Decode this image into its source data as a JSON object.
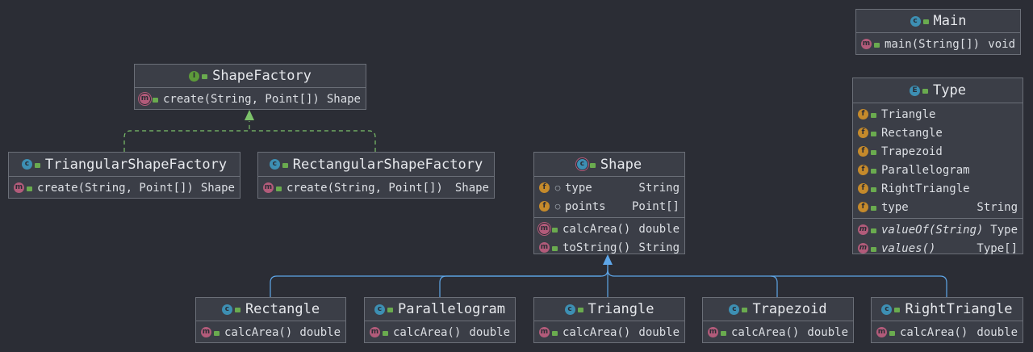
{
  "colors": {
    "background": "#2b2d35",
    "box_fill": "#3b3e47",
    "border": "#6b6f78",
    "inherit_edge": "#5ea6e8",
    "realize_edge": "#7cc26a"
  },
  "main": {
    "title": "Main",
    "methods": [
      {
        "name": "main(String[])",
        "type": "void"
      }
    ]
  },
  "shape_factory": {
    "title": "ShapeFactory",
    "methods": [
      {
        "name": "create(String, Point[])",
        "type": "Shape"
      }
    ]
  },
  "triangular_factory": {
    "title": "TriangularShapeFactory",
    "methods": [
      {
        "name": "create(String, Point[])",
        "type": "Shape"
      }
    ]
  },
  "rectangular_factory": {
    "title": "RectangularShapeFactory",
    "methods": [
      {
        "name": "create(String, Point[])",
        "type": "Shape"
      }
    ]
  },
  "shape": {
    "title": "Shape",
    "fields": [
      {
        "name": "type",
        "type": "String"
      },
      {
        "name": "points",
        "type": "Point[]"
      }
    ],
    "methods": [
      {
        "name": "calcArea()",
        "type": "double"
      },
      {
        "name": "toString()",
        "type": "String"
      }
    ]
  },
  "type_enum": {
    "title": "Type",
    "constants": [
      "Triangle",
      "Rectangle",
      "Trapezoid",
      "Parallelogram",
      "RightTriangle"
    ],
    "fields": [
      {
        "name": "type",
        "type": "String"
      }
    ],
    "methods": [
      {
        "name": "valueOf(String)",
        "type": "Type"
      },
      {
        "name": "values()",
        "type": "Type[]"
      }
    ]
  },
  "rectangle": {
    "title": "Rectangle",
    "methods": [
      {
        "name": "calcArea()",
        "type": "double"
      }
    ]
  },
  "parallelogram": {
    "title": "Parallelogram",
    "methods": [
      {
        "name": "calcArea()",
        "type": "double"
      }
    ]
  },
  "triangle": {
    "title": "Triangle",
    "methods": [
      {
        "name": "calcArea()",
        "type": "double"
      }
    ]
  },
  "trapezoid": {
    "title": "Trapezoid",
    "methods": [
      {
        "name": "calcArea()",
        "type": "double"
      }
    ]
  },
  "right_triangle": {
    "title": "RightTriangle",
    "methods": [
      {
        "name": "calcArea()",
        "type": "double"
      }
    ]
  }
}
